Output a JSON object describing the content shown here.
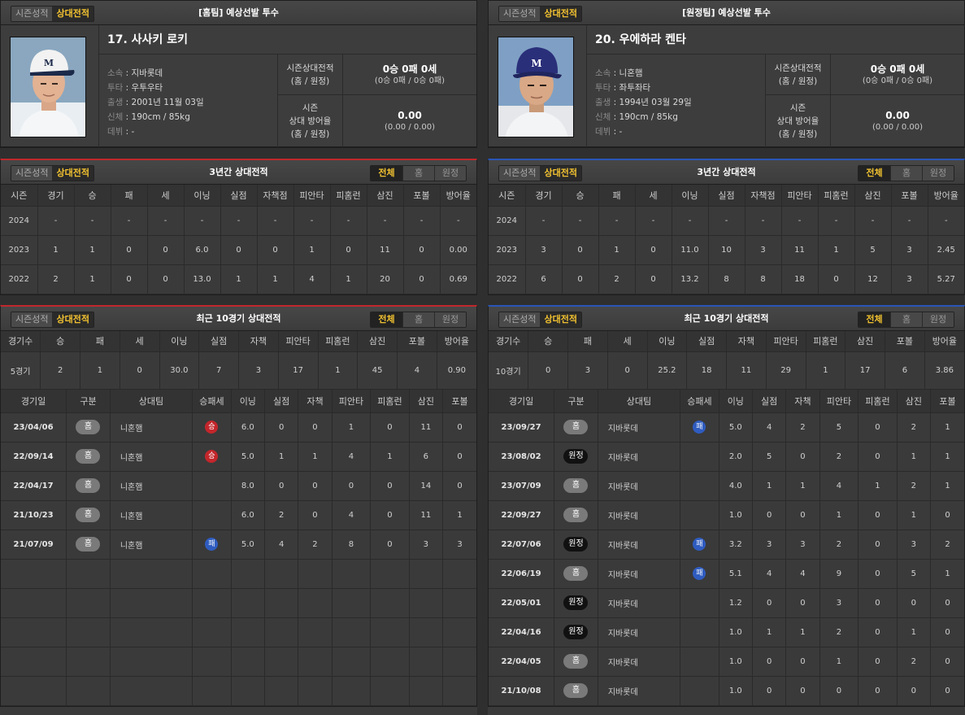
{
  "tabs": {
    "season": "시즌성적",
    "versus": "상대전적"
  },
  "range_tabs": [
    "전체",
    "홈",
    "원정"
  ],
  "home": {
    "header_title": "[홈팀] 예상선발 투수",
    "name": "17. 사사키 로키",
    "info": [
      {
        "k": "소속",
        "v": "지바롯데"
      },
      {
        "k": "투타",
        "v": "우투우타"
      },
      {
        "k": "출생",
        "v": "2001년 11월 03일"
      },
      {
        "k": "신체",
        "v": "190cm / 85kg"
      },
      {
        "k": "데뷔",
        "v": "-"
      }
    ],
    "season_vs_label_1": "시즌상대전적",
    "season_vs_label_2": "(홈 / 원정)",
    "season_vs_value": "0승 0패 0세",
    "season_vs_sub": "(0승 0패 / 0승 0패)",
    "era_label_1": "시즌",
    "era_label_2": "상대 방어율",
    "era_label_3": "(홈 / 원정)",
    "era_value": "0.00",
    "era_sub": "(0.00 / 0.00)",
    "three_year_title": "3년간 상대전적",
    "three_year_headers": [
      "시즌",
      "경기",
      "승",
      "패",
      "세",
      "이닝",
      "실점",
      "자책점",
      "피안타",
      "피홈런",
      "삼진",
      "포볼",
      "방어율"
    ],
    "three_year_rows": [
      [
        "2024",
        "-",
        "-",
        "-",
        "-",
        "-",
        "-",
        "-",
        "-",
        "-",
        "-",
        "-",
        "-"
      ],
      [
        "2023",
        "1",
        "1",
        "0",
        "0",
        "6.0",
        "0",
        "0",
        "1",
        "0",
        "11",
        "0",
        "0.00"
      ],
      [
        "2022",
        "2",
        "1",
        "0",
        "0",
        "13.0",
        "1",
        "1",
        "4",
        "1",
        "20",
        "0",
        "0.69"
      ]
    ],
    "recent_title": "최근 10경기 상대전적",
    "recent_summary_headers": [
      "경기수",
      "승",
      "패",
      "세",
      "이닝",
      "실점",
      "자책",
      "피안타",
      "피홈런",
      "삼진",
      "포볼",
      "방어율"
    ],
    "recent_summary": [
      "5경기",
      "2",
      "1",
      "0",
      "30.0",
      "7",
      "3",
      "17",
      "1",
      "45",
      "4",
      "0.90"
    ],
    "game_headers": [
      "경기일",
      "구분",
      "상대팀",
      "승패세",
      "이닝",
      "실점",
      "자책",
      "피안타",
      "피홈런",
      "삼진",
      "포볼"
    ],
    "games": [
      {
        "date": "23/04/06",
        "type": "홈",
        "away": false,
        "opp": "니혼햄",
        "res": "승",
        "win": true,
        "ip": "6.0",
        "r": "0",
        "er": "0",
        "h": "1",
        "hr": "0",
        "so": "11",
        "bb": "0"
      },
      {
        "date": "22/09/14",
        "type": "홈",
        "away": false,
        "opp": "니혼햄",
        "res": "승",
        "win": true,
        "ip": "5.0",
        "r": "1",
        "er": "1",
        "h": "4",
        "hr": "1",
        "so": "6",
        "bb": "0"
      },
      {
        "date": "22/04/17",
        "type": "홈",
        "away": false,
        "opp": "니혼햄",
        "res": "",
        "win": false,
        "ip": "8.0",
        "r": "0",
        "er": "0",
        "h": "0",
        "hr": "0",
        "so": "14",
        "bb": "0"
      },
      {
        "date": "21/10/23",
        "type": "홈",
        "away": false,
        "opp": "니혼햄",
        "res": "",
        "win": false,
        "ip": "6.0",
        "r": "2",
        "er": "0",
        "h": "4",
        "hr": "0",
        "so": "11",
        "bb": "1"
      },
      {
        "date": "21/07/09",
        "type": "홈",
        "away": false,
        "opp": "니혼햄",
        "res": "패",
        "win": false,
        "ip": "5.0",
        "r": "4",
        "er": "2",
        "h": "8",
        "hr": "0",
        "so": "3",
        "bb": "3"
      }
    ],
    "empty_rows": 5
  },
  "away": {
    "header_title": "[원정팀] 예상선발 투수",
    "name": "20. 우에하라 켄타",
    "info": [
      {
        "k": "소속",
        "v": "니혼햄"
      },
      {
        "k": "투타",
        "v": "좌투좌타"
      },
      {
        "k": "출생",
        "v": "1994년 03월 29일"
      },
      {
        "k": "신체",
        "v": "190cm / 85kg"
      },
      {
        "k": "데뷔",
        "v": "-"
      }
    ],
    "season_vs_label_1": "시즌상대전적",
    "season_vs_label_2": "(홈 / 원정)",
    "season_vs_value": "0승 0패 0세",
    "season_vs_sub": "(0승 0패 / 0승 0패)",
    "era_label_1": "시즌",
    "era_label_2": "상대 방어율",
    "era_label_3": "(홈 / 원정)",
    "era_value": "0.00",
    "era_sub": "(0.00 / 0.00)",
    "three_year_title": "3년간 상대전적",
    "three_year_headers": [
      "시즌",
      "경기",
      "승",
      "패",
      "세",
      "이닝",
      "실점",
      "자책점",
      "피안타",
      "피홈런",
      "삼진",
      "포볼",
      "방어율"
    ],
    "three_year_rows": [
      [
        "2024",
        "-",
        "-",
        "-",
        "-",
        "-",
        "-",
        "-",
        "-",
        "-",
        "-",
        "-",
        "-"
      ],
      [
        "2023",
        "3",
        "0",
        "1",
        "0",
        "11.0",
        "10",
        "3",
        "11",
        "1",
        "5",
        "3",
        "2.45"
      ],
      [
        "2022",
        "6",
        "0",
        "2",
        "0",
        "13.2",
        "8",
        "8",
        "18",
        "0",
        "12",
        "3",
        "5.27"
      ]
    ],
    "recent_title": "최근 10경기 상대전적",
    "recent_summary_headers": [
      "경기수",
      "승",
      "패",
      "세",
      "이닝",
      "실점",
      "자책",
      "피안타",
      "피홈런",
      "삼진",
      "포볼",
      "방어율"
    ],
    "recent_summary": [
      "10경기",
      "0",
      "3",
      "0",
      "25.2",
      "18",
      "11",
      "29",
      "1",
      "17",
      "6",
      "3.86"
    ],
    "game_headers": [
      "경기일",
      "구분",
      "상대팀",
      "승패세",
      "이닝",
      "실점",
      "자책",
      "피안타",
      "피홈런",
      "삼진",
      "포볼"
    ],
    "games": [
      {
        "date": "23/09/27",
        "type": "홈",
        "away": false,
        "opp": "지바롯데",
        "res": "패",
        "win": false,
        "ip": "5.0",
        "r": "4",
        "er": "2",
        "h": "5",
        "hr": "0",
        "so": "2",
        "bb": "1"
      },
      {
        "date": "23/08/02",
        "type": "원정",
        "away": true,
        "opp": "지바롯데",
        "res": "",
        "win": false,
        "ip": "2.0",
        "r": "5",
        "er": "0",
        "h": "2",
        "hr": "0",
        "so": "1",
        "bb": "1"
      },
      {
        "date": "23/07/09",
        "type": "홈",
        "away": false,
        "opp": "지바롯데",
        "res": "",
        "win": false,
        "ip": "4.0",
        "r": "1",
        "er": "1",
        "h": "4",
        "hr": "1",
        "so": "2",
        "bb": "1"
      },
      {
        "date": "22/09/27",
        "type": "홈",
        "away": false,
        "opp": "지바롯데",
        "res": "",
        "win": false,
        "ip": "1.0",
        "r": "0",
        "er": "0",
        "h": "1",
        "hr": "0",
        "so": "1",
        "bb": "0"
      },
      {
        "date": "22/07/06",
        "type": "원정",
        "away": true,
        "opp": "지바롯데",
        "res": "패",
        "win": false,
        "ip": "3.2",
        "r": "3",
        "er": "3",
        "h": "2",
        "hr": "0",
        "so": "3",
        "bb": "2"
      },
      {
        "date": "22/06/19",
        "type": "홈",
        "away": false,
        "opp": "지바롯데",
        "res": "패",
        "win": false,
        "ip": "5.1",
        "r": "4",
        "er": "4",
        "h": "9",
        "hr": "0",
        "so": "5",
        "bb": "1"
      },
      {
        "date": "22/05/01",
        "type": "원정",
        "away": true,
        "opp": "지바롯데",
        "res": "",
        "win": false,
        "ip": "1.2",
        "r": "0",
        "er": "0",
        "h": "3",
        "hr": "0",
        "so": "0",
        "bb": "0"
      },
      {
        "date": "22/04/16",
        "type": "원정",
        "away": true,
        "opp": "지바롯데",
        "res": "",
        "win": false,
        "ip": "1.0",
        "r": "1",
        "er": "1",
        "h": "2",
        "hr": "0",
        "so": "1",
        "bb": "0"
      },
      {
        "date": "22/04/05",
        "type": "홈",
        "away": false,
        "opp": "지바롯데",
        "res": "",
        "win": false,
        "ip": "1.0",
        "r": "0",
        "er": "0",
        "h": "1",
        "hr": "0",
        "so": "2",
        "bb": "0"
      },
      {
        "date": "21/10/08",
        "type": "홈",
        "away": false,
        "opp": "지바롯데",
        "res": "",
        "win": false,
        "ip": "1.0",
        "r": "0",
        "er": "0",
        "h": "0",
        "hr": "0",
        "so": "0",
        "bb": "0"
      }
    ],
    "empty_rows": 0
  }
}
